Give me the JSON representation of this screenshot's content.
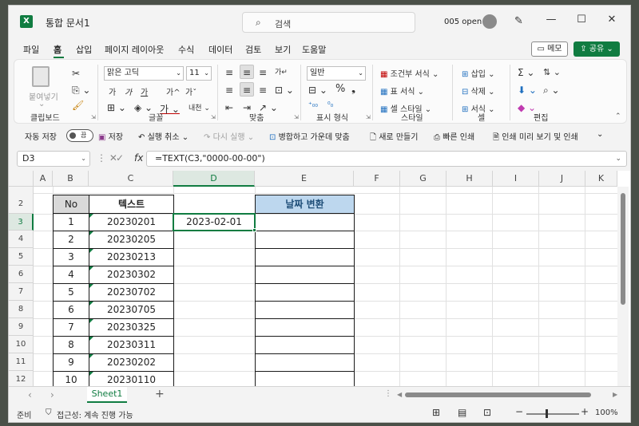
{
  "window": {
    "app_icon": "X",
    "title": "통합 문서1",
    "search_placeholder": "검색",
    "user": "005 open",
    "controls": [
      "—",
      "☐",
      "✕"
    ]
  },
  "menu": {
    "items": [
      "파일",
      "홈",
      "삽입",
      "페이지 레이아웃",
      "수식",
      "데이터",
      "검토",
      "보기",
      "도움말"
    ],
    "active": "홈",
    "memo": "메모",
    "share": "공유"
  },
  "ribbon": {
    "clipboard": {
      "paste": "붙여넣기",
      "label": "클립보드"
    },
    "font": {
      "name": "맑은 고딕",
      "size": "11",
      "buttons_row2": [
        "가",
        "가",
        "가",
        "가^",
        "가ˇ"
      ],
      "label": "글꼴"
    },
    "alignment": {
      "label": "맞춤"
    },
    "number": {
      "format": "일반",
      "label": "표시 형식"
    },
    "styles": {
      "items": [
        "조건부 서식",
        "표 서식",
        "셀 스타일"
      ],
      "label": "스타일"
    },
    "cells": {
      "items": [
        "삽입",
        "삭제",
        "서식"
      ],
      "label": "셀"
    },
    "editing": {
      "label": "편집"
    }
  },
  "qat": {
    "autosave": "자동 저장",
    "toggle": "끔",
    "save": "저장",
    "undo": "실행 취소",
    "redo": "다시 실행",
    "merge": "병합하고 가운데 맞춤",
    "new": "새로 만들기",
    "quick_print": "빠른 인쇄",
    "print_preview": "인쇄 미리 보기 및 인쇄"
  },
  "formula_bar": {
    "name_box": "D3",
    "fx": "fx",
    "formula": "=TEXT(C3,\"0000-00-00\")"
  },
  "grid": {
    "columns": [
      "A",
      "B",
      "C",
      "D",
      "E",
      "F",
      "G",
      "H",
      "I",
      "J",
      "K"
    ],
    "rows": [
      "2",
      "3",
      "4",
      "5",
      "6",
      "7",
      "8",
      "9",
      "10",
      "11",
      "12"
    ],
    "selected_column": "D",
    "selected_row": "3",
    "header_no": "No",
    "header_text": "텍스트",
    "header_date": "날짜 변환",
    "numbers": [
      "1",
      "2",
      "3",
      "4",
      "5",
      "6",
      "7",
      "8",
      "9",
      "10"
    ],
    "texts": [
      "20230201",
      "20230205",
      "20230213",
      "20230302",
      "20230702",
      "20230705",
      "20230325",
      "20230311",
      "20230202",
      "20230110"
    ],
    "d3_value": "2023-02-01"
  },
  "sheets": {
    "tabs": [
      "Sheet1"
    ],
    "add": "+"
  },
  "status": {
    "ready": "준비",
    "accessibility": "접근성: 계속 진행 가능",
    "zoom": "100%",
    "zoom_fraction": 1.0
  }
}
